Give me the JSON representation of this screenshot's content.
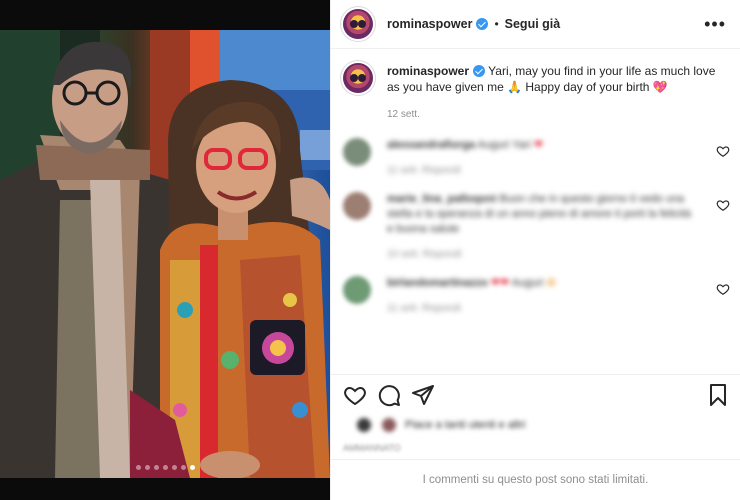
{
  "post": {
    "username": "rominaspower",
    "follow_status": "Segui già",
    "separator": "•",
    "more_icon": "more-horizontal-icon"
  },
  "caption": {
    "username": "rominaspower",
    "text": "Yari, may you find in your life as much love as you have given me",
    "text_tail": "Happy day of your birth",
    "time": "12 sett."
  },
  "comments": [
    {
      "username": "alessandrafiorga",
      "text": "Auguri Yari",
      "meta": "11 sett.   Rispondi"
    },
    {
      "username": "marie_lina_palloqoni",
      "text": "Buon che in questo giorno ti vedo una stella e la speranza di un anno pieno di amore ti porti la felicità e buona salute",
      "meta": "10 sett.   Rispondi"
    },
    {
      "username": "birlandomartinazzo",
      "text": "Auguri",
      "meta": "11 sett.   Rispondi"
    }
  ],
  "likes": {
    "text": "Piace a tanti utenti e altri"
  },
  "date_line": "AMMANNATO",
  "footer": {
    "limited": "I commenti su questo post sono stati limitati."
  },
  "carousel": {
    "count": 7,
    "active_index": 6
  },
  "colors": {
    "accent": "#3897f0",
    "heart": "#e83e6c",
    "muted": "#8e8e8e"
  }
}
